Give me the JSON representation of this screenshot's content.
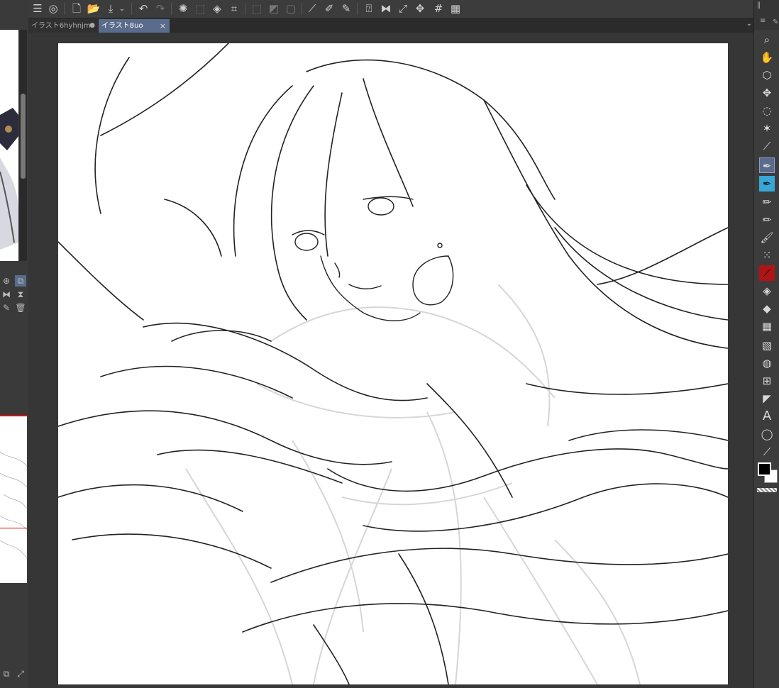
{
  "tabs": [
    {
      "label": "イラスト6hyhnjm*",
      "active": false,
      "modified_marker": "●"
    },
    {
      "label": "イラスト8uo",
      "active": true,
      "close_glyph": "×"
    }
  ],
  "tab_overflow_glyph": "⌄",
  "toolbar_icons": [
    "menu-icon",
    "layer-icon",
    "new-file-icon",
    "open-folder-icon",
    "save-icon",
    "dropdown-icon",
    "undo-icon",
    "redo-icon",
    "loading-icon",
    "clear-icon",
    "fill-icon",
    "crop-icon",
    "select-none-icon",
    "invert-selection-icon",
    "selection-border-icon",
    "ruler-icon",
    "stroke-icon",
    "pen-settings-icon",
    "help-icon",
    "flip-icon",
    "fit-icon",
    "move-icon",
    "grid-icon",
    "grid-fine-icon"
  ],
  "tools": [
    "zoom-icon",
    "hand-icon",
    "object-icon",
    "move-layer-icon",
    "lasso-icon",
    "magic-wand-icon",
    "eyedropper-icon",
    "pen-icon",
    "pen-alt-icon",
    "pencil-icon",
    "pencil-alt-icon",
    "brush-icon",
    "airbrush-icon",
    "decoration-icon",
    "fill-bucket-icon",
    "eraser-icon",
    "mesh-icon",
    "gradient-icon",
    "blend-icon",
    "frame-icon",
    "ruler-tool-icon",
    "text-icon",
    "balloon-icon",
    "correction-icon"
  ],
  "colors": {
    "main": "#000000",
    "sub": "#ffffff",
    "accent": "#5a6c8c",
    "pen_highlight": "#39a7d6"
  }
}
